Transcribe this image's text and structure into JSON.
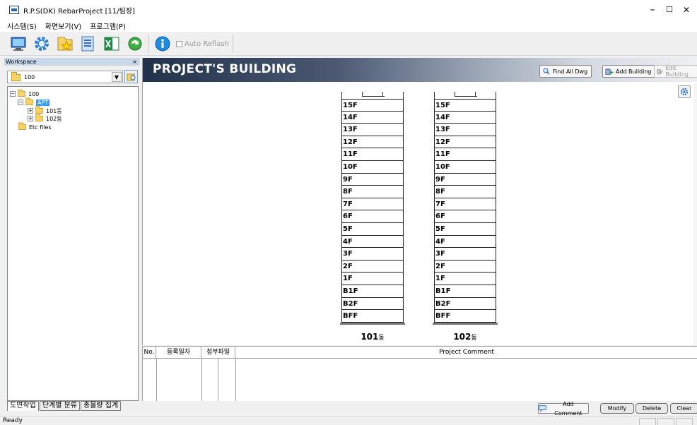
{
  "window": {
    "title": "R.P.S(DK) RebarProject [11/팀장]",
    "minimize": "–",
    "maximize": "☐",
    "close": "✕"
  },
  "menu": [
    "시스템(S)",
    "화면보기(V)",
    "프로그램(P)"
  ],
  "toolbar": {
    "buttons": [
      "monitor-icon",
      "gear-icon",
      "star-folder-icon",
      "document-icon",
      "excel-icon",
      "refresh-icon",
      "info-icon"
    ],
    "auto_reflash_label": "Auto Reflash",
    "auto_reflash_checked": false
  },
  "workspace": {
    "header": "Workspace",
    "close": "×",
    "combo_value": "100",
    "tree": {
      "root": "100",
      "apt": "APT",
      "b101": "101동",
      "b102": "102동",
      "etc": "Etc files"
    },
    "tabs": [
      "도면작업",
      "단계별 분류",
      "총물량 집계"
    ],
    "active_tab": "도면작업"
  },
  "main": {
    "title": "PROJECT'S BUILDING",
    "find_all": "Find All Dwg",
    "add_building": "Add Building",
    "edit_building": "Edit Building",
    "buildings": [
      {
        "name": "101",
        "suffix": "동",
        "floors": [
          "15F",
          "14F",
          "13F",
          "12F",
          "11F",
          "10F",
          "9F",
          "8F",
          "7F",
          "6F",
          "5F",
          "4F",
          "3F",
          "2F",
          "1F",
          "B1F",
          "B2F",
          "BFF"
        ]
      },
      {
        "name": "102",
        "suffix": "동",
        "floors": [
          "15F",
          "14F",
          "13F",
          "12F",
          "11F",
          "10F",
          "9F",
          "8F",
          "7F",
          "6F",
          "5F",
          "4F",
          "3F",
          "2F",
          "1F",
          "B1F",
          "B2F",
          "BFF"
        ]
      }
    ]
  },
  "comments": {
    "columns": [
      "No.",
      "등록일자",
      "첨부파일",
      "Project Comment"
    ],
    "add_comment": "Add Comment",
    "modify": "Modify",
    "delete": "Delete",
    "clear": "Clear"
  },
  "status": {
    "text": "Ready"
  }
}
